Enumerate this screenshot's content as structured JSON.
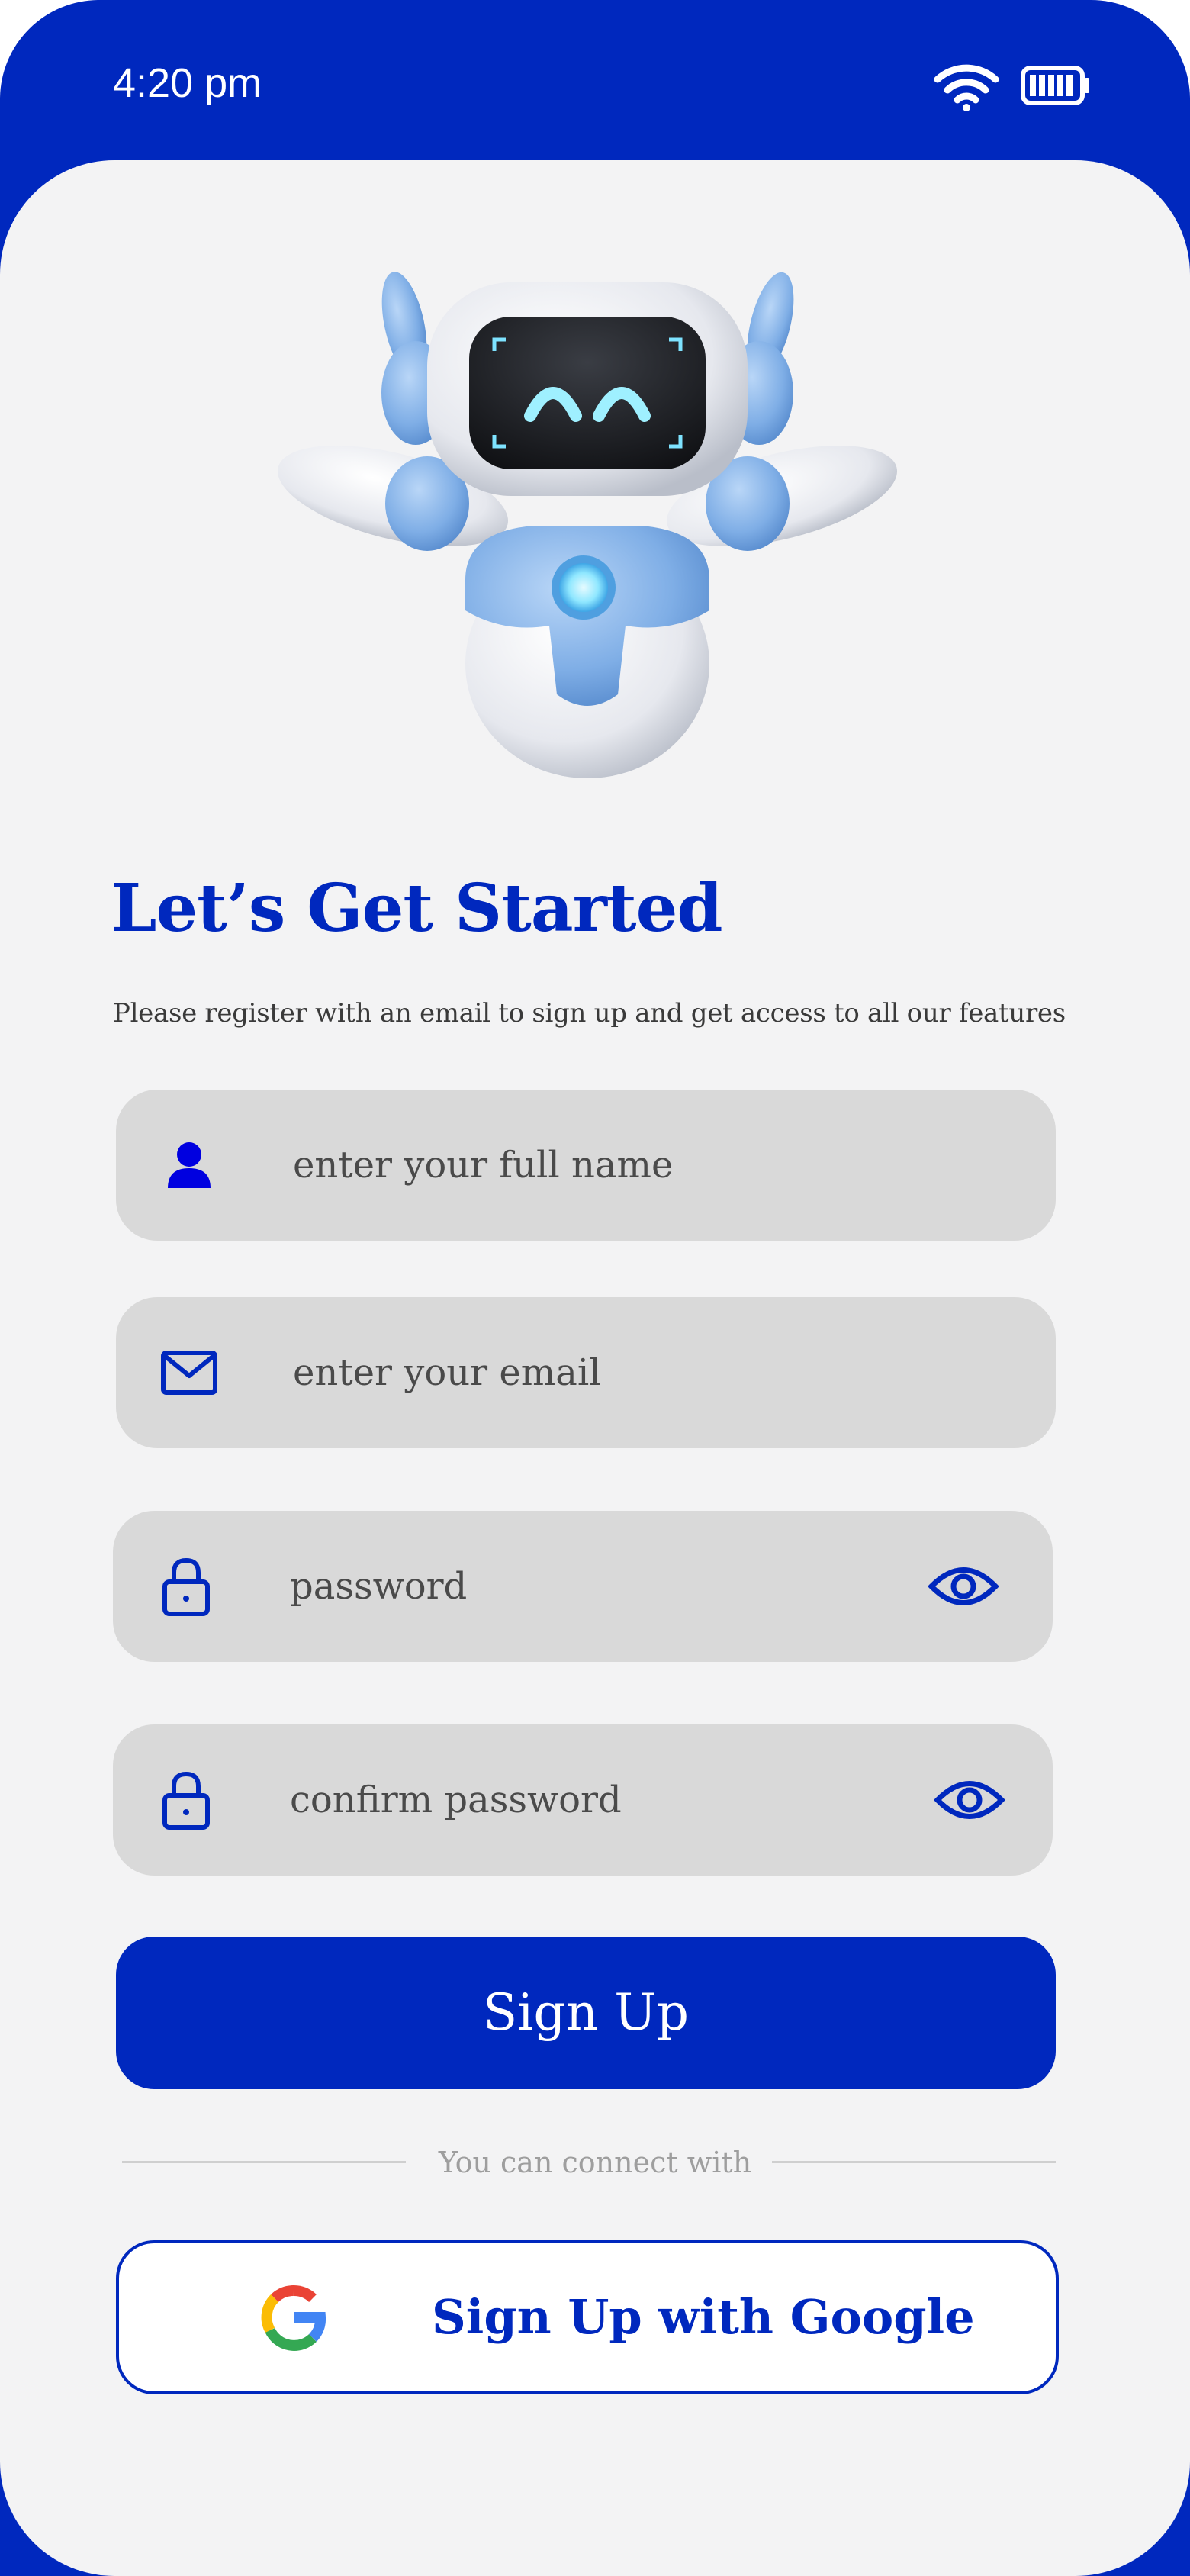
{
  "status_bar": {
    "time": "4:20 pm",
    "wifi_icon": "wifi-icon",
    "battery_icon": "battery-icon"
  },
  "hero": {
    "image": "robot-mascot"
  },
  "heading": {
    "title": "Let’s Get Started",
    "subtitle": "Please register with an email to sign up and get access to all our features"
  },
  "form": {
    "full_name": {
      "placeholder": "enter your full name",
      "icon": "user-icon"
    },
    "email": {
      "placeholder": "enter your email",
      "icon": "mail-icon"
    },
    "password": {
      "placeholder": "password",
      "icon": "lock-icon",
      "toggle_icon": "eye-icon"
    },
    "confirm_password": {
      "placeholder": "confirm password",
      "icon": "lock-icon",
      "toggle_icon": "eye-icon"
    }
  },
  "actions": {
    "sign_up": "Sign Up",
    "divider_text": "You can connect with",
    "google": "Sign Up with Google",
    "google_icon": "google-logo-icon"
  },
  "colors": {
    "primary": "#0028BE",
    "background": "#F3F3F4",
    "field": "#D9D9D9"
  }
}
